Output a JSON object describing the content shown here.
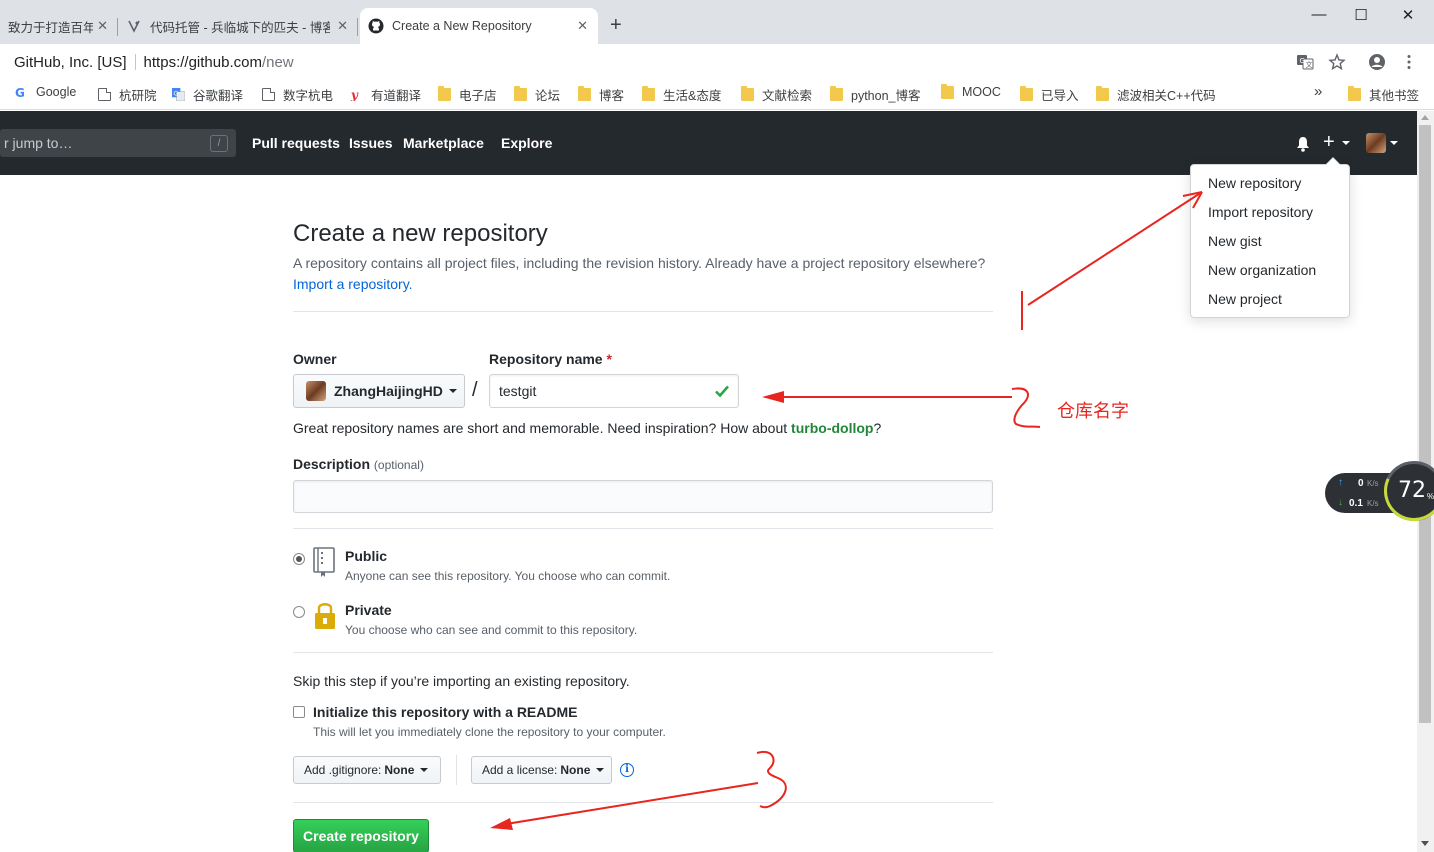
{
  "browser": {
    "tabs": [
      {
        "title": "致力于打造百年"
      },
      {
        "title": "代码托管 - 兵临城下的匹夫 - 博客"
      },
      {
        "title": "Create a New Repository"
      }
    ],
    "new_tab": "+",
    "window_controls": {
      "minimize": "—",
      "maximize": "☐",
      "close": "✕"
    },
    "site_org": "GitHub, Inc. [US]",
    "url_host": "https://github.com",
    "url_path": "/new",
    "bookmarks": [
      {
        "label": "Google",
        "icon": "google-icon"
      },
      {
        "label": "杭研院",
        "icon": "page-icon"
      },
      {
        "label": "谷歌翻译",
        "icon": "translate-icon"
      },
      {
        "label": "数字杭电",
        "icon": "page-icon"
      },
      {
        "label": "有道翻译",
        "icon": "youdao-icon"
      },
      {
        "label": "电子店",
        "icon": "folder-icon"
      },
      {
        "label": "论坛",
        "icon": "folder-icon"
      },
      {
        "label": "博客",
        "icon": "folder-icon"
      },
      {
        "label": "生活&态度",
        "icon": "folder-icon"
      },
      {
        "label": "文献检索",
        "icon": "folder-icon"
      },
      {
        "label": "python_博客",
        "icon": "folder-icon"
      },
      {
        "label": "MOOC",
        "icon": "folder-icon"
      },
      {
        "label": "已导入",
        "icon": "folder-icon"
      },
      {
        "label": "滤波相关C++代码",
        "icon": "folder-icon"
      }
    ],
    "bookmarks_overflow": "»",
    "other_bookmarks": "其他书签"
  },
  "github": {
    "search_placeholder": "r jump to…",
    "search_shortcut": "/",
    "nav": [
      "Pull requests",
      "Issues",
      "Marketplace",
      "Explore"
    ],
    "menu": [
      "New repository",
      "Import repository",
      "New gist",
      "New organization",
      "New project"
    ]
  },
  "form": {
    "title": "Create a new repository",
    "lead": "A repository contains all project files, including the revision history. Already have a project repository elsewhere?",
    "import_link": "Import a repository.",
    "owner_label": "Owner",
    "owner_value": "ZhangHaijingHD",
    "repo_label": "Repository name",
    "required_mark": "*",
    "separator": "/",
    "repo_value": "testgit",
    "hint_prefix": "Great repository names are short and memorable. Need inspiration? How about ",
    "hint_suggestion": "turbo-dollop",
    "hint_suffix": "?",
    "desc_label": "Description",
    "desc_optional": "(optional)",
    "desc_value": "",
    "visibility": [
      {
        "title": "Public",
        "note": "Anyone can see this repository. You choose who can commit.",
        "selected": true
      },
      {
        "title": "Private",
        "note": "You choose who can see and commit to this repository.",
        "selected": false
      }
    ],
    "skip_text": "Skip this step if you’re importing an existing repository.",
    "init_label": "Initialize this repository with a README",
    "init_note": "This will let you immediately clone the repository to your computer.",
    "init_checked": false,
    "gitignore_prefix": "Add .gitignore:",
    "gitignore_value": "None",
    "license_prefix": "Add a license:",
    "license_value": "None",
    "info_glyph": "i",
    "submit": "Create repository"
  },
  "speed_widget": {
    "upload": "0",
    "upload_unit": "K/s",
    "download": "0.1",
    "download_unit": "K/s",
    "percent": "72",
    "percent_unit": "%"
  },
  "annotations": {
    "label_2": "仓库名字"
  }
}
